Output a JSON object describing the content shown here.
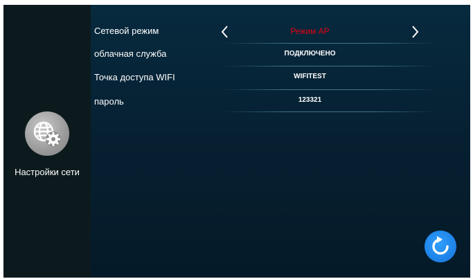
{
  "sidebar": {
    "icon": "globe-gear-icon",
    "label": "Настройки сети"
  },
  "settings": {
    "network_mode": {
      "label": "Сетевой режим",
      "value": "Режим AP",
      "value_color": "#e60012",
      "prev_icon": "chevron-left-icon",
      "next_icon": "chevron-right-icon"
    },
    "cloud_service": {
      "label": "облачная служба",
      "value": "ПОДКЛЮЧЕНО"
    },
    "wifi_access_point": {
      "label": "Точка доступа WIFI",
      "value": "WIFITEST"
    },
    "password": {
      "label": "пароль",
      "value": "123321"
    }
  },
  "actions": {
    "refresh_icon": "refresh-icon",
    "accent_color": "#1e88e5"
  }
}
